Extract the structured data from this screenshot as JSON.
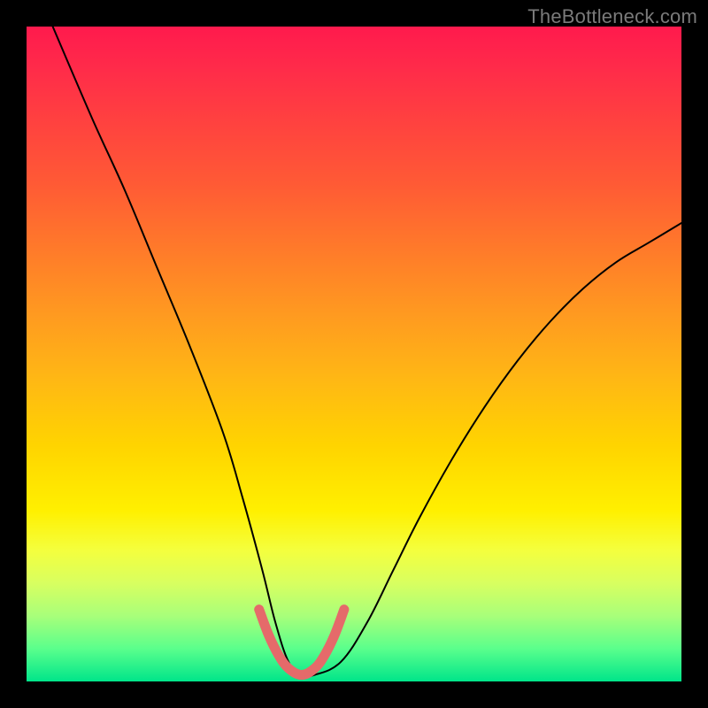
{
  "watermark": "TheBottleneck.com",
  "chart_data": {
    "type": "line",
    "title": "",
    "xlabel": "",
    "ylabel": "",
    "xlim": [
      0,
      100
    ],
    "ylim": [
      0,
      100
    ],
    "grid": false,
    "legend": false,
    "annotations": [],
    "series": [
      {
        "name": "main-curve",
        "color": "#000000",
        "x": [
          4,
          10,
          15,
          20,
          25,
          30,
          33,
          36,
          38,
          40,
          42,
          44,
          48,
          52,
          56,
          60,
          65,
          70,
          75,
          80,
          85,
          90,
          95,
          100
        ],
        "values": [
          100,
          86,
          75,
          63,
          51,
          38,
          28,
          17,
          9,
          3,
          1,
          1,
          3,
          9,
          17,
          25,
          34,
          42,
          49,
          55,
          60,
          64,
          67,
          70
        ]
      },
      {
        "name": "notch-highlight",
        "color": "#e56a6a",
        "x": [
          35.5,
          37,
          38.5,
          40,
          42,
          44,
          45.5,
          47,
          48.5
        ],
        "values": [
          11,
          7,
          4,
          2,
          1,
          2,
          4,
          7,
          11
        ]
      }
    ],
    "background_gradient": {
      "top": "#ff1a4d",
      "mid_upper": "#ff9a20",
      "mid": "#fff000",
      "mid_lower": "#d8ff60",
      "bottom": "#00e58a"
    }
  }
}
